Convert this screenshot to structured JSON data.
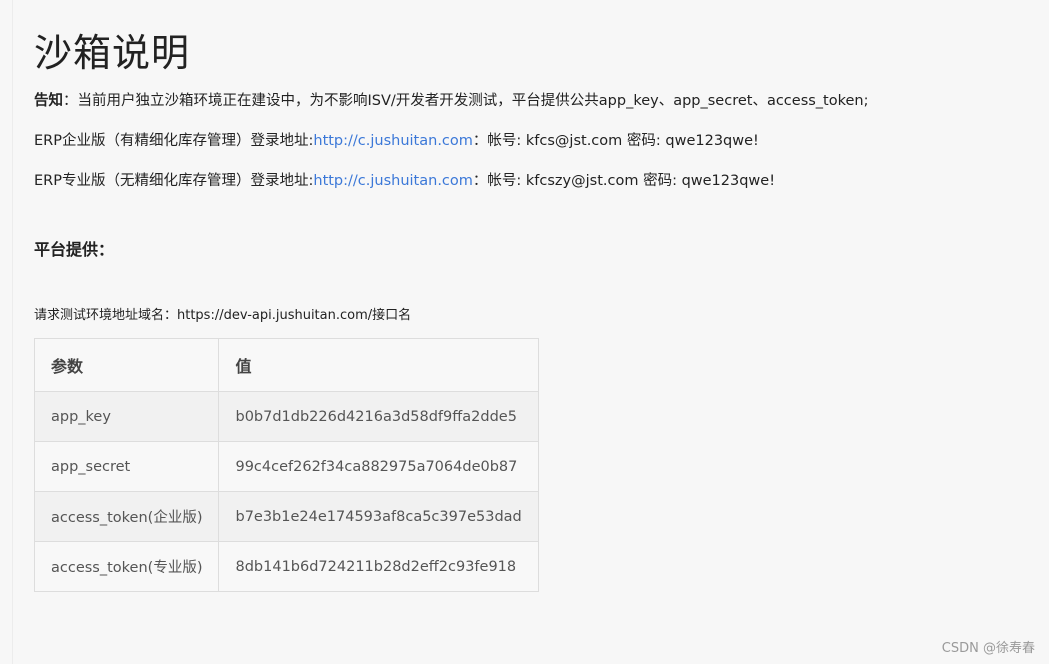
{
  "page": {
    "title": "沙箱说明",
    "notice": {
      "label": "告知",
      "separator": "：",
      "text": "当前用户独立沙箱环境正在建设中，为不影响ISV/开发者开发测试，平台提供公共app_key、app_secret、access_token;"
    },
    "erp_lines": [
      {
        "prefix": "ERP企业版（有精细化库存管理）登录地址:",
        "url": "http://c.jushuitan.com",
        "account_text": "：帐号: kfcs@jst.com 密码: qwe123qwe!"
      },
      {
        "prefix": "ERP专业版（无精细化库存管理）登录地址:",
        "url": "http://c.jushuitan.com",
        "account_text": "：帐号: kfcszy@jst.com 密码: qwe123qwe!"
      }
    ],
    "section_title": "平台提供：",
    "base_url_text": "请求测试环境地址域名：https://dev-api.jushuitan.com/接口名"
  },
  "table": {
    "headers": [
      "参数",
      "值"
    ],
    "rows": [
      {
        "param": "app_key",
        "value": "b0b7d1db226d4216a3d58df9ffa2dde5"
      },
      {
        "param": "app_secret",
        "value": "99c4cef262f34ca882975a7064de0b87"
      },
      {
        "param": "access_token(企业版)",
        "value": "b7e3b1e24e174593af8ca5c397e53dad"
      },
      {
        "param": "access_token(专业版)",
        "value": "8db141b6d724211b28d2eff2c93fe918"
      }
    ]
  },
  "watermark": "CSDN @徐寿春",
  "colors": {
    "link": "#3b78d8",
    "background": "#f7f7f7",
    "table_border": "#dddddd"
  }
}
